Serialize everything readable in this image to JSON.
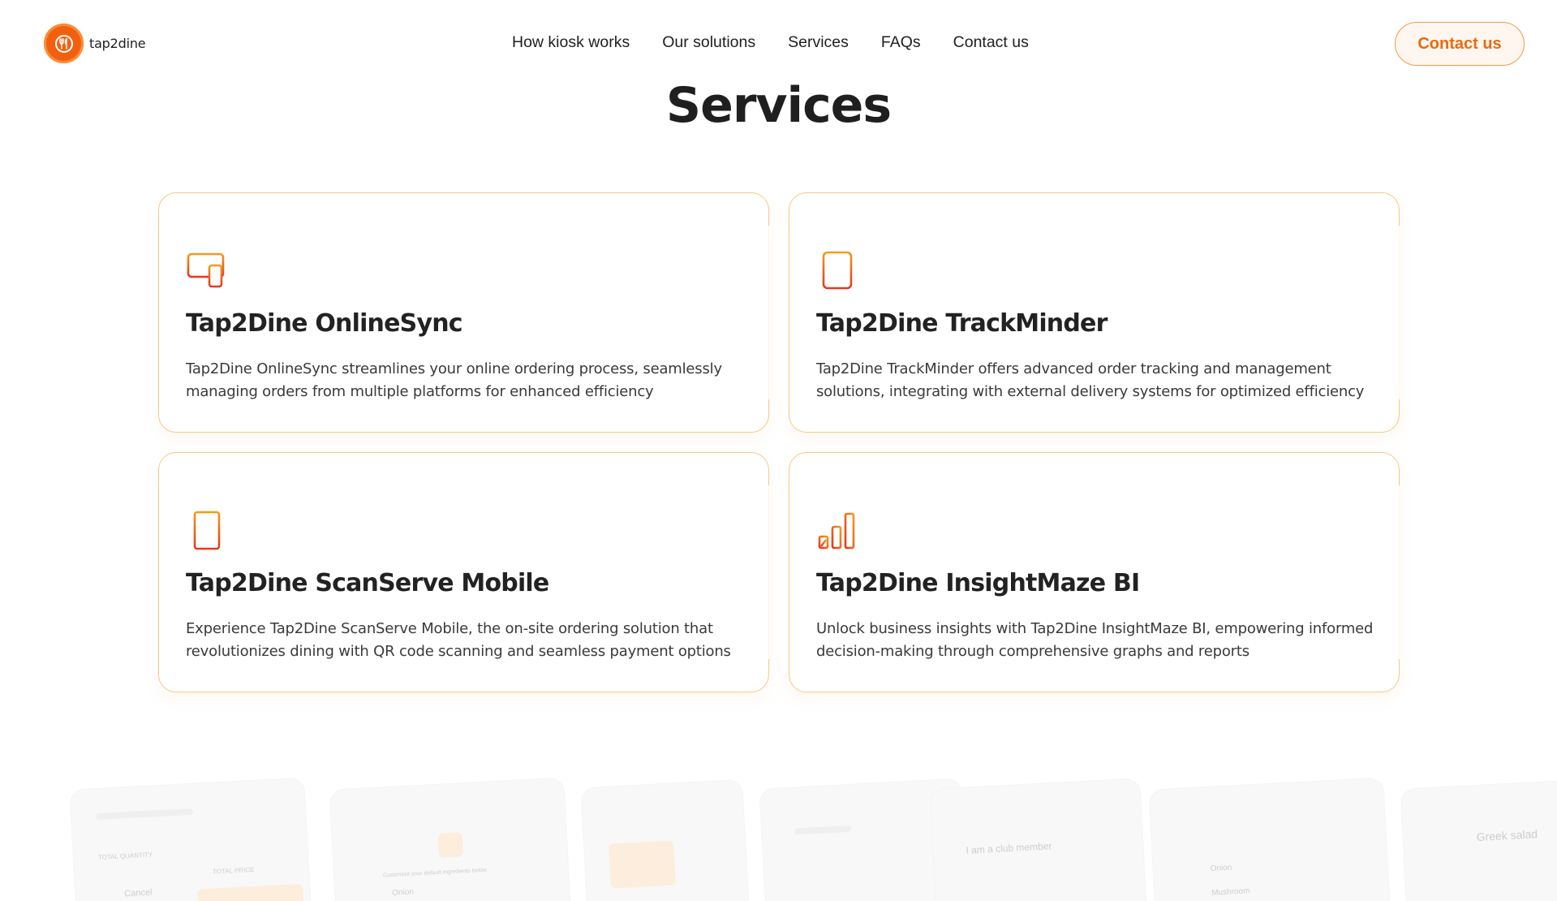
{
  "header": {
    "logo_text": "tap2dine",
    "nav": [
      "How kiosk works",
      "Our solutions",
      "Services",
      "FAQs",
      "Contact us"
    ],
    "cta_label": "Contact us"
  },
  "page": {
    "title": "Services"
  },
  "services": [
    {
      "icon": "devices-icon",
      "title": "Tap2Dine OnlineSync",
      "description": "Tap2Dine OnlineSync streamlines your online ordering process, seamlessly managing orders from multiple platforms for enhanced efficiency"
    },
    {
      "icon": "document-icon",
      "title": "Tap2Dine TrackMinder",
      "description": "Tap2Dine TrackMinder offers advanced order tracking and management solutions, integrating with external delivery systems for optimized efficiency"
    },
    {
      "icon": "mobile-phone-icon",
      "title": "Tap2Dine ScanServe Mobile",
      "description": "Experience Tap2Dine ScanServe Mobile, the on-site ordering solution that revolutionizes dining with QR code scanning and seamless payment options"
    },
    {
      "icon": "bar-chart-icon",
      "title": "Tap2Dine InsightMaze BI",
      "description": "Unlock business insights with Tap2Dine InsightMaze BI, empowering informed decision-making through comprehensive graphs and reports"
    }
  ],
  "preview": {
    "labels": [
      "TOTAL QUANTITY",
      "TOTAL PRICE",
      "Cancel",
      "Onion",
      "I am a club member",
      "Onion",
      "Mushroom",
      "Greek salad",
      "Customize your default ingredients below"
    ]
  },
  "colors": {
    "accent": "#ea6a0c",
    "card_border": "#f7c985",
    "logo_bg": "#f2600f"
  }
}
